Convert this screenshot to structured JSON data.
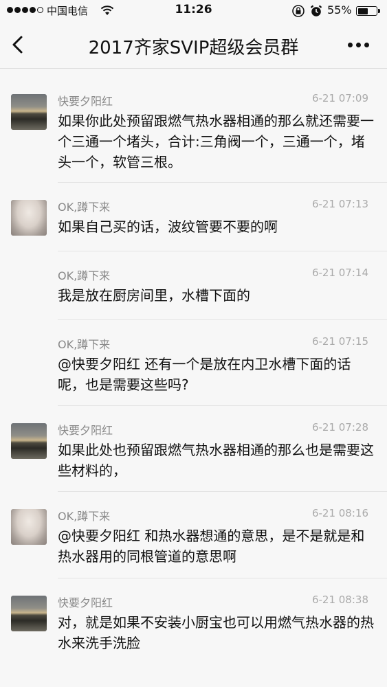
{
  "status_bar": {
    "carrier": "中国电信",
    "time": "11:26",
    "battery": "55%",
    "battery_level": 0.55
  },
  "nav": {
    "title": "2017齐家SVIP超级会员群"
  },
  "messages": [
    {
      "sender": "快要夕阳红",
      "time": "6-21 07:09",
      "text": "如果你此处预留跟燃气热水器相通的那么就还需要一个三通一个堵头，合计:三角阀一个，三通一个，堵头一个，软管三根。",
      "avatar": "sunset-avatar"
    },
    {
      "sender": "OK,蹲下来",
      "time": "6-21 07:13",
      "text": "如果自己买的话，波纹管要不要的啊",
      "avatar": "hand-avatar"
    },
    {
      "sender": "OK,蹲下来",
      "time": "6-21 07:14",
      "text": "我是放在厨房间里，水槽下面的",
      "avatar": ""
    },
    {
      "sender": "OK,蹲下来",
      "time": "6-21 07:15",
      "text": "@快要夕阳红 还有一个是放在内卫水槽下面的话呢，也是需要这些吗?",
      "avatar": ""
    },
    {
      "sender": "快要夕阳红",
      "time": "6-21 07:28",
      "text": "如果此处也预留跟燃气热水器相通的那么也是需要这些材料的，",
      "avatar": "sunset-avatar"
    },
    {
      "sender": "OK,蹲下来",
      "time": "6-21 08:16",
      "text": "@快要夕阳红 和热水器想通的意思，是不是就是和热水器用的同根管道的意思啊",
      "avatar": "hand-avatar"
    },
    {
      "sender": "快要夕阳红",
      "time": "6-21 08:38",
      "text": "对，就是如果不安装小厨宝也可以用燃气热水器的热水来洗手洗脸",
      "avatar": "sunset-avatar"
    }
  ]
}
